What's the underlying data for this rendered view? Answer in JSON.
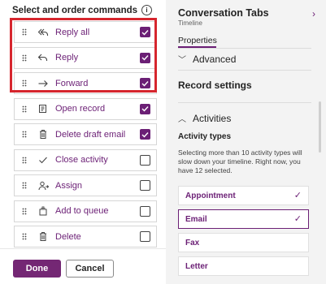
{
  "left_panel": {
    "header": "Select and order commands",
    "info_icon": "i",
    "commands": [
      {
        "label": "Reply all",
        "icon": "reply-all-icon",
        "checked": true
      },
      {
        "label": "Reply",
        "icon": "reply-icon",
        "checked": true
      },
      {
        "label": "Forward",
        "icon": "forward-icon",
        "checked": true
      },
      {
        "label": "Open record",
        "icon": "open-record-icon",
        "checked": true
      },
      {
        "label": "Delete draft email",
        "icon": "delete-icon",
        "checked": true
      },
      {
        "label": "Close activity",
        "icon": "checkmark-icon",
        "checked": false
      },
      {
        "label": "Assign",
        "icon": "assign-icon",
        "checked": false
      },
      {
        "label": "Add to queue",
        "icon": "queue-icon",
        "checked": false
      },
      {
        "label": "Delete",
        "icon": "delete-icon",
        "checked": false
      }
    ],
    "done_label": "Done",
    "cancel_label": "Cancel"
  },
  "right_panel": {
    "title": "Conversation Tabs",
    "subtitle": "Timeline",
    "tab": "Properties",
    "advanced_label": "Advanced",
    "record_settings_label": "Record settings",
    "activities_label": "Activities",
    "activity_types_label": "Activity types",
    "note": "Selecting more than 10 activity types will slow down your timeline. Right now, you have 12 selected.",
    "activities": [
      {
        "label": "Appointment",
        "selected": true,
        "outlined": false
      },
      {
        "label": "Email",
        "selected": true,
        "outlined": true
      },
      {
        "label": "Fax",
        "selected": false,
        "outlined": false
      },
      {
        "label": "Letter",
        "selected": false,
        "outlined": false
      }
    ]
  },
  "colors": {
    "accent": "#6b1f75",
    "highlight_box": "#d6262e"
  }
}
